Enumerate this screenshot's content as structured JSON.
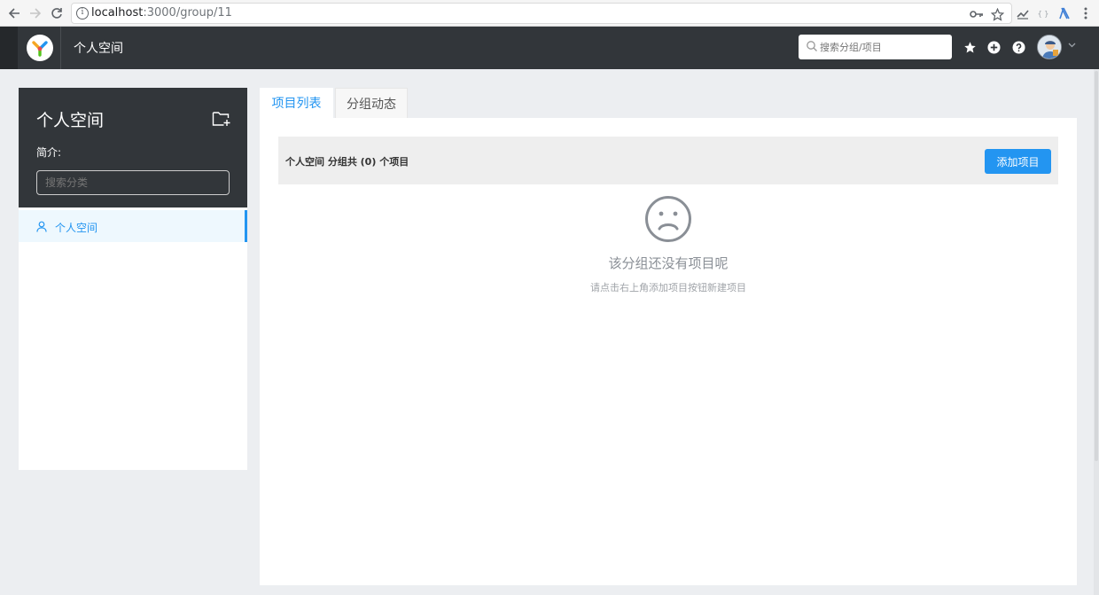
{
  "browser": {
    "url_host": "localhost",
    "url_path": ":3000/group/11",
    "icons": [
      "back-icon",
      "forward-icon",
      "reload-icon",
      "info-icon",
      "key-icon",
      "star-icon",
      "extension-icon",
      "menu-icon"
    ]
  },
  "header": {
    "title": "个人空间",
    "search_placeholder": "搜索分组/项目",
    "icons": [
      "star-icon",
      "plus-circle-icon",
      "question-icon",
      "avatar",
      "caret-down-icon"
    ]
  },
  "sidebar": {
    "title": "个人空间",
    "description_label": "简介:",
    "search_placeholder": "搜索分类",
    "items": [
      {
        "label": "个人空间",
        "icon": "user-icon",
        "active": true
      }
    ]
  },
  "tabs": [
    {
      "label": "项目列表",
      "active": true
    },
    {
      "label": "分组动态",
      "active": false
    }
  ],
  "project_list": {
    "summary": "个人空间 分组共 (0) 个项目",
    "add_button": "添加项目",
    "empty_title": "该分组还没有项目呢",
    "empty_desc": "请点击右上角添加项目按钮新建项目"
  },
  "colors": {
    "accent": "#2395f1",
    "header_bg": "#32363a",
    "page_bg": "#eceef1"
  }
}
